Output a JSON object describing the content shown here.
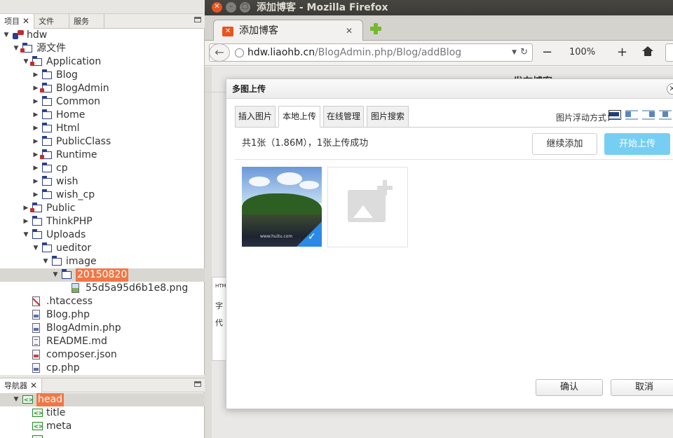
{
  "ide": {
    "panel_tabs": [
      {
        "label": "项目",
        "close": "✕"
      },
      {
        "label": "文件",
        "close": ""
      },
      {
        "label": "服务",
        "close": ""
      }
    ],
    "tree": [
      {
        "label": "hdw",
        "level": 0,
        "twisty": "▼",
        "icon": "project",
        "selected": false
      },
      {
        "label": "源文件",
        "level": 1,
        "twisty": "▼",
        "icon": "folder-red",
        "selected": false
      },
      {
        "label": "Application",
        "level": 2,
        "twisty": "▼",
        "icon": "folder-red",
        "selected": false
      },
      {
        "label": "Blog",
        "level": 3,
        "twisty": "▶",
        "icon": "folder",
        "selected": false
      },
      {
        "label": "BlogAdmin",
        "level": 3,
        "twisty": "▶",
        "icon": "folder-red",
        "selected": false
      },
      {
        "label": "Common",
        "level": 3,
        "twisty": "▶",
        "icon": "folder",
        "selected": false
      },
      {
        "label": "Home",
        "level": 3,
        "twisty": "▶",
        "icon": "folder",
        "selected": false
      },
      {
        "label": "Html",
        "level": 3,
        "twisty": "▶",
        "icon": "folder",
        "selected": false
      },
      {
        "label": "PublicClass",
        "level": 3,
        "twisty": "▶",
        "icon": "folder",
        "selected": false
      },
      {
        "label": "Runtime",
        "level": 3,
        "twisty": "▶",
        "icon": "folder-red",
        "selected": false
      },
      {
        "label": "cp",
        "level": 3,
        "twisty": "▶",
        "icon": "folder",
        "selected": false
      },
      {
        "label": "wish",
        "level": 3,
        "twisty": "▶",
        "icon": "folder",
        "selected": false
      },
      {
        "label": "wish_cp",
        "level": 3,
        "twisty": "▶",
        "icon": "folder",
        "selected": false
      },
      {
        "label": "Public",
        "level": 2,
        "twisty": "▶",
        "icon": "folder-red",
        "selected": false
      },
      {
        "label": "ThinkPHP",
        "level": 2,
        "twisty": "▶",
        "icon": "folder",
        "selected": false
      },
      {
        "label": "Uploads",
        "level": 2,
        "twisty": "▼",
        "icon": "folder",
        "selected": false
      },
      {
        "label": "ueditor",
        "level": 3,
        "twisty": "▼",
        "icon": "folder",
        "selected": false
      },
      {
        "label": "image",
        "level": 4,
        "twisty": "▼",
        "icon": "folder",
        "selected": false
      },
      {
        "label": "20150820",
        "level": 5,
        "twisty": "▼",
        "icon": "folder",
        "selected": true
      },
      {
        "label": "55d5a95d6b1e8.png",
        "level": 6,
        "twisty": "",
        "icon": "file-img",
        "selected": false
      },
      {
        "label": ".htaccess",
        "level": 2,
        "twisty": "",
        "icon": "file-ht",
        "selected": false
      },
      {
        "label": "Blog.php",
        "level": 2,
        "twisty": "",
        "icon": "file-php",
        "selected": false
      },
      {
        "label": "BlogAdmin.php",
        "level": 2,
        "twisty": "",
        "icon": "file-php",
        "selected": false
      },
      {
        "label": "README.md",
        "level": 2,
        "twisty": "",
        "icon": "file-md",
        "selected": false
      },
      {
        "label": "composer.json",
        "level": 2,
        "twisty": "",
        "icon": "file-json",
        "selected": false
      },
      {
        "label": "cp.php",
        "level": 2,
        "twisty": "",
        "icon": "file-php",
        "selected": false
      }
    ],
    "navigator_tab": {
      "label": "导航器",
      "close": "✕"
    },
    "navigator": [
      {
        "label": "head",
        "level": 1,
        "twisty": "▼",
        "selected": true
      },
      {
        "label": "title",
        "level": 2,
        "twisty": "",
        "selected": false
      },
      {
        "label": "meta",
        "level": 2,
        "twisty": "",
        "selected": false
      },
      {
        "label": "",
        "level": 2,
        "twisty": "",
        "selected": false
      }
    ]
  },
  "firefox": {
    "window_title": "添加博客 - Mozilla Firefox",
    "window_buttons": {
      "close": "✕",
      "minimize": "–",
      "maximize": "□"
    },
    "tab": {
      "title": "添加博客",
      "close": "✕"
    },
    "url": {
      "domain": "hdw.liaohb.cn",
      "path": "/BlogAdmin.php/Blog/addBlog"
    },
    "zoom": {
      "out": "−",
      "level": "100%",
      "in": "+"
    },
    "page_title_partial": "发布博客",
    "editor_fragments": [
      "HTML",
      "字",
      "代"
    ]
  },
  "dialog": {
    "title": "多图上传",
    "close": "✕",
    "tabs": [
      "插入图片",
      "本地上传",
      "在线管理",
      "图片搜索"
    ],
    "active_tab_index": 1,
    "float_label": "图片浮动方式：",
    "float_options": [
      "none",
      "left",
      "right",
      "center"
    ],
    "status": "共1张（1.86M），1张上传成功",
    "add_more": "继续添加",
    "start_upload": "开始上传",
    "uploaded_count": 1,
    "thumb_watermark": "www.huitu.com",
    "ok": "确认",
    "cancel": "取消"
  },
  "colors": {
    "accent_orange": "#f07746",
    "ubuntu_orange": "#e95420",
    "upload_button": "#76cff2",
    "check_blue": "#2b8ae6"
  }
}
